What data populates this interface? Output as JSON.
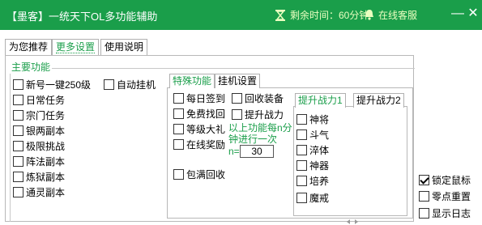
{
  "window": {
    "title": "【墨客】一统天下OL多功能辅助",
    "timer_text": "剩余时间：60分钟",
    "service_text": "在线客服",
    "minimize_glyph": "—",
    "close_glyph": "✕",
    "accent_color": "#1a9e4a"
  },
  "tabs": [
    {
      "label": "为您推荐",
      "active": false
    },
    {
      "label": "更多设置",
      "active": true
    },
    {
      "label": "使用说明",
      "active": false
    }
  ],
  "main_group": {
    "title": "主要功能",
    "items": [
      {
        "label": "新号一键250级",
        "checked": false
      },
      {
        "label": "日常任务",
        "checked": false
      },
      {
        "label": "宗门任务",
        "checked": false
      },
      {
        "label": "银两副本",
        "checked": false
      },
      {
        "label": "极限挑战",
        "checked": false
      },
      {
        "label": "阵法副本",
        "checked": false
      },
      {
        "label": "炼狱副本",
        "checked": false
      },
      {
        "label": "通灵副本",
        "checked": false
      }
    ],
    "auto_hangup": {
      "label": "自动挂机",
      "checked": false
    }
  },
  "sub_tabs": [
    {
      "label": "特殊功能",
      "active": true
    },
    {
      "label": "挂机设置",
      "active": false
    }
  ],
  "special": {
    "left_items": [
      {
        "label": "每日签到",
        "checked": false
      },
      {
        "label": "免费找回",
        "checked": false
      },
      {
        "label": "等级大礼",
        "checked": false
      },
      {
        "label": "在线奖励",
        "checked": false
      }
    ],
    "recycle_equip": {
      "label": "回收装备",
      "checked": false
    },
    "boost_power": {
      "label": "提升战力",
      "checked": false
    },
    "note_line1": "以上功能每n分",
    "note_line2": "钟进行一次",
    "n_label": "n=",
    "n_value": "30",
    "full_recycle": {
      "label": "包满回收",
      "checked": false
    }
  },
  "power_tabs": [
    {
      "label": "提升战力1",
      "active": true
    },
    {
      "label": "提升战力2",
      "active": false
    }
  ],
  "power_items": [
    {
      "label": "神将",
      "checked": false
    },
    {
      "label": "斗气",
      "checked": false
    },
    {
      "label": "淬体",
      "checked": false
    },
    {
      "label": "神器",
      "checked": false
    },
    {
      "label": "培养",
      "checked": false
    },
    {
      "label": "魔戒",
      "checked": false
    }
  ],
  "right_options": [
    {
      "label": "锁定鼠标",
      "checked": true
    },
    {
      "label": "零点重置",
      "checked": false
    },
    {
      "label": "显示日志",
      "checked": false
    }
  ]
}
